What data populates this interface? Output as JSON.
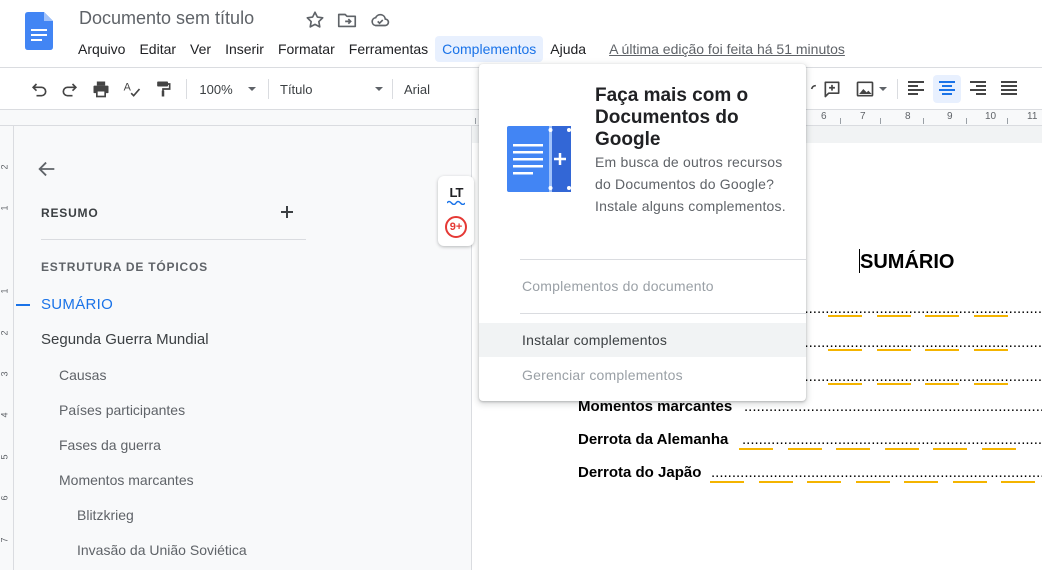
{
  "app": {
    "doc_title": "Documento sem título",
    "brand_color": "#4285f4"
  },
  "menubar": {
    "items": [
      "Arquivo",
      "Editar",
      "Ver",
      "Inserir",
      "Formatar",
      "Ferramentas",
      "Complementos",
      "Ajuda"
    ],
    "active_item": "Complementos",
    "last_edit": "A última edição foi feita há 51 minutos"
  },
  "toolbar": {
    "zoom": "100%",
    "style": "Título",
    "font": "Arial",
    "icons": [
      "undo-icon",
      "redo-icon",
      "print-icon",
      "spellcheck-icon",
      "paint-format-icon",
      "link-icon",
      "add-comment-icon",
      "insert-image-icon",
      "align-left-icon",
      "align-center-icon",
      "align-right-icon",
      "align-justify-icon"
    ],
    "active_alignment": "center"
  },
  "ruler": {
    "horizontal": [
      "6",
      "7",
      "8",
      "9",
      "10",
      "11"
    ],
    "vertical": [
      "2",
      "1",
      "1",
      "2",
      "3",
      "4",
      "5",
      "6",
      "7"
    ]
  },
  "sidebar": {
    "summary_label": "RESUMO",
    "outline_label": "ESTRUTURA DE TÓPICOS",
    "outline": [
      {
        "text": "SUMÁRIO",
        "level": 0,
        "selected": true
      },
      {
        "text": "Segunda Guerra Mundial",
        "level": 1
      },
      {
        "text": "Causas",
        "level": 2
      },
      {
        "text": "Países participantes",
        "level": 2
      },
      {
        "text": "Fases da guerra",
        "level": 2
      },
      {
        "text": "Momentos marcantes",
        "level": 2
      },
      {
        "text": "Blitzkrieg",
        "level": 3
      },
      {
        "text": "Invasão da União Soviética",
        "level": 3
      }
    ]
  },
  "addons_chip": {
    "badge": "9+",
    "logo": "LT"
  },
  "document": {
    "heading": "SUMÁRIO",
    "toc_entries": [
      "Momentos marcantes",
      "Derrota da Alemanha",
      "Derrota do Japão"
    ]
  },
  "dropdown": {
    "promo_title": "Faça mais com o Documentos do Google",
    "promo_body": "Em busca de outros recursos do Documentos do Google? Instale alguns complementos.",
    "items": [
      {
        "label": "Complementos do documento",
        "state": "disabled"
      },
      {
        "label": "Instalar complementos",
        "state": "hover"
      },
      {
        "label": "Gerenciar complementos",
        "state": "disabled"
      }
    ]
  }
}
